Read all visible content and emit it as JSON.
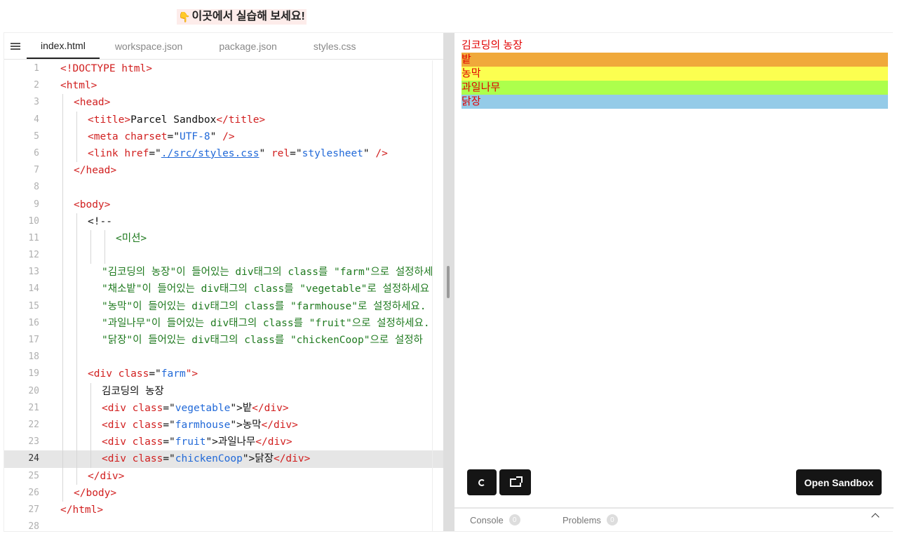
{
  "banner": {
    "icon": "pointing-down-hand",
    "text": "이곳에서 실습해 보세요!"
  },
  "editor": {
    "tabs": [
      "index.html",
      "workspace.json",
      "package.json",
      "styles.css"
    ],
    "active_tab": "index.html",
    "current_line": 24,
    "line_numbers": [
      "1",
      "2",
      "3",
      "4",
      "5",
      "6",
      "7",
      "8",
      "9",
      "10",
      "11",
      "12",
      "13",
      "14",
      "15",
      "16",
      "17",
      "18",
      "19",
      "20",
      "21",
      "22",
      "23",
      "24",
      "25",
      "26",
      "27",
      "28"
    ],
    "code": {
      "l1_a": "<!DOCTYPE html>",
      "l2_a": "<html>",
      "l3_a": "<head>",
      "l4_a": "<title>",
      "l4_b": "Parcel Sandbox",
      "l4_c": "</title>",
      "l5_a": "<meta ",
      "l5_b": "charset",
      "l5_c": "=\"",
      "l5_d": "UTF-8",
      "l5_e": "\" ",
      "l5_f": "/>",
      "l6_a": "<link ",
      "l6_b": "href",
      "l6_c": "=\"",
      "l6_d": "./src/styles.css",
      "l6_e": "\" ",
      "l6_f": "rel",
      "l6_g": "=\"",
      "l6_h": "stylesheet",
      "l6_i": "\" ",
      "l6_j": "/>",
      "l7_a": "</head>",
      "l9_a": "<body>",
      "l10_a": "<!--",
      "l11_a": "<미션>",
      "l13_a": "\"김코딩의 농장\"이 들어있는 div태그의 class를 \"farm\"으로 설정하세",
      "l14_a": "\"채소밭\"이 들어있는 div태그의 class를 \"vegetable\"로 설정하세요",
      "l15_a": "\"농막\"이 들어있는 div태그의 class를 \"farmhouse\"로 설정하세요.",
      "l16_a": "\"과일나무\"이 들어있는 div태그의 class를 \"fruit\"으로 설정하세요.",
      "l17_a": "\"닭장\"이 들어있는 div태그의 class를 \"chickenCoop\"으로 설정하",
      "l19_a": "<div ",
      "l19_b": "class",
      "l19_c": "=\"",
      "l19_d": "farm",
      "l19_e": "\">",
      "l20_a": "김코딩의 농장",
      "l21_a": "<div ",
      "l21_b": "class",
      "l21_c": "=\"",
      "l21_d": "vegetable",
      "l21_e": "\">",
      "l21_f": "밭",
      "l21_g": "</div>",
      "l22_a": "<div ",
      "l22_b": "class",
      "l22_c": "=\"",
      "l22_d": "farmhouse",
      "l22_e": "\">",
      "l22_f": "농막",
      "l22_g": "</div>",
      "l23_a": "<div ",
      "l23_b": "class",
      "l23_c": "=\"",
      "l23_d": "fruit",
      "l23_e": "\">",
      "l23_f": "과일나무",
      "l23_g": "</div>",
      "l24_a": "<div ",
      "l24_b": "class",
      "l24_c": "=\"",
      "l24_d": "chickenCoop",
      "l24_e": "\">",
      "l24_f": "닭장",
      "l24_g": "</div>",
      "l25_a": "</div>",
      "l26_a": "</body>",
      "l27_a": "</html>"
    }
  },
  "preview": {
    "farm_title": "김코딩의 농장",
    "rows": [
      {
        "text": "밭",
        "color": "#f0a93b"
      },
      {
        "text": "농막",
        "color": "#fcff50"
      },
      {
        "text": "과일나무",
        "color": "#adff4c"
      },
      {
        "text": "닭장",
        "color": "#94cbe8"
      }
    ],
    "text_color": "#e10000",
    "refresh_icon": "refresh-icon",
    "open_new_window_icon": "external-window-icon",
    "open_sandbox_label": "Open Sandbox"
  },
  "bottom_bar": {
    "console_label": "Console",
    "console_count": "0",
    "problems_label": "Problems",
    "problems_count": "0",
    "collapse_icon": "chevron-up-icon"
  }
}
